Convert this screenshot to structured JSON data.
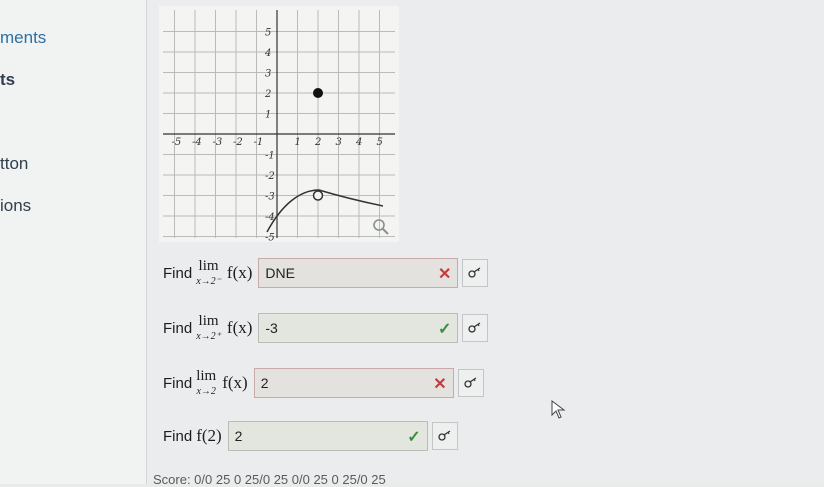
{
  "sidebar": {
    "items": [
      {
        "label": "ments"
      },
      {
        "label": "ts"
      },
      {
        "label": "tton"
      },
      {
        "label": "ions"
      }
    ]
  },
  "graph": {
    "x_ticks": [
      "-5",
      "-4",
      "-3",
      "-2",
      "-1",
      "1",
      "2",
      "3",
      "4",
      "5"
    ],
    "y_ticks": [
      "5",
      "4",
      "3",
      "2",
      "1",
      "-1",
      "-2",
      "-3",
      "-4",
      "-5"
    ],
    "closed_point": {
      "x": 2,
      "y": 2
    },
    "open_point": {
      "x": 2,
      "y": -3
    },
    "zoom_icon": "magnifier-icon"
  },
  "questions": [
    {
      "find": "Find",
      "lim": "lim",
      "sub": "x→2⁻",
      "func": "f(x)",
      "answer": "DNE",
      "status": "wrong"
    },
    {
      "find": "Find",
      "lim": "lim",
      "sub": "x→2⁺",
      "func": "f(x)",
      "answer": "-3",
      "status": "correct"
    },
    {
      "find": "Find",
      "lim": "lim",
      "sub": "x→2",
      "func": "f(x)",
      "answer": "2",
      "status": "wrong"
    },
    {
      "find": "Find",
      "lim": "",
      "sub": "",
      "func": "f(2)",
      "answer": "2",
      "status": "correct"
    }
  ],
  "marks": {
    "wrong": "✕",
    "correct": "✓"
  },
  "colors": {
    "wrong": "#c43d3d",
    "correct": "#3a8f3a"
  },
  "score": "Score: 0/0 25 0 25/0 25 0/0 25 0 25/0 25"
}
